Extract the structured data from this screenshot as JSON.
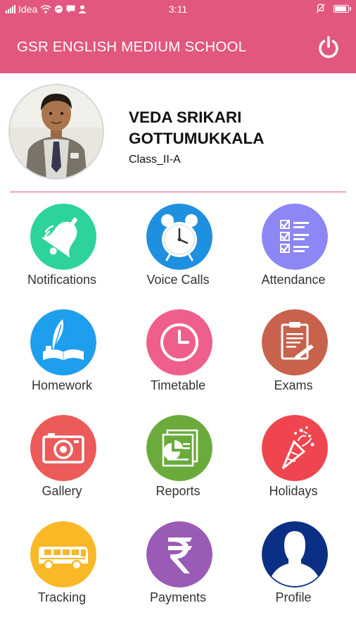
{
  "status_bar": {
    "carrier": "Idea",
    "time": "3:11"
  },
  "app_bar": {
    "title": "GSR ENGLISH MEDIUM SCHOOL"
  },
  "student": {
    "name": "VEDA SRIKARI GOTTUMUKKALA",
    "class": "Class_II-A"
  },
  "menu": {
    "notifications": {
      "label": "Notifications",
      "color": "#2ed39a",
      "icon": "bell-icon"
    },
    "voice_calls": {
      "label": "Voice Calls",
      "color": "#1f8fe0",
      "icon": "alarm-clock-icon"
    },
    "attendance": {
      "label": "Attendance",
      "color": "#8c87f4",
      "icon": "checklist-icon"
    },
    "homework": {
      "label": "Homework",
      "color": "#1e9fed",
      "icon": "book-quill-icon"
    },
    "timetable": {
      "label": "Timetable",
      "color": "#ee5f8c",
      "icon": "clock-icon"
    },
    "exams": {
      "label": "Exams",
      "color": "#c8624c",
      "icon": "clipboard-icon"
    },
    "gallery": {
      "label": "Gallery",
      "color": "#ec5a5a",
      "icon": "camera-icon"
    },
    "reports": {
      "label": "Reports",
      "color": "#6aab3c",
      "icon": "reports-icon"
    },
    "holidays": {
      "label": "Holidays",
      "color": "#f0454f",
      "icon": "party-popper-icon"
    },
    "tracking": {
      "label": "Tracking",
      "color": "#f9b825",
      "icon": "bus-icon"
    },
    "payments": {
      "label": "Payments",
      "color": "#9a5bb6",
      "icon": "rupee-icon"
    },
    "profile": {
      "label": "Profile",
      "color": "#0c2f86",
      "icon": "person-silhouette-icon"
    }
  }
}
